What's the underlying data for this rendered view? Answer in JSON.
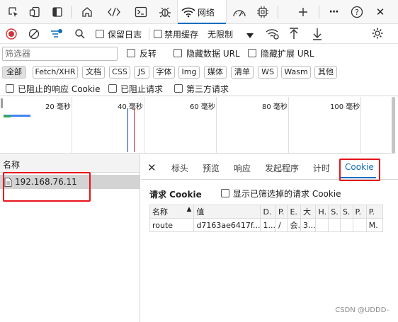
{
  "toolbar": {
    "active_tab_label": "网络",
    "more_label": "···",
    "help_label": "?",
    "close_label": "✕"
  },
  "network_toolbar": {
    "preserve_log_label": "保留日志",
    "disable_cache_label": "禁用缓存",
    "throttle_value": "无限制"
  },
  "filter": {
    "placeholder": "筛选器",
    "invert_label": "反转",
    "hide_data_url_label": "隐藏数据 URL",
    "hide_ext_url_label": "隐藏扩展 URL"
  },
  "type_filters": [
    "全部",
    "Fetch/XHR",
    "文档",
    "CSS",
    "JS",
    "字体",
    "Img",
    "媒体",
    "清单",
    "WS",
    "Wasm",
    "其他"
  ],
  "row3": {
    "blocked_response_cookie": "已阻止的响应 Cookie",
    "blocked_requests": "已阻止请求",
    "third_party_requests": "第三方请求"
  },
  "overview": {
    "ticks": [
      "20 毫秒",
      "40 毫秒",
      "60 毫秒",
      "80 毫秒",
      "100 毫秒"
    ]
  },
  "requests": {
    "name_header": "名称",
    "items": [
      "192.168.76.11"
    ]
  },
  "details": {
    "close_label": "✕",
    "tabs": [
      "标头",
      "预览",
      "响应",
      "发起程序",
      "计时",
      "Cookie"
    ],
    "active_tab": "Cookie",
    "section_title": "请求 Cookie",
    "show_filtered_label": "显示已筛选掉的请求 Cookie",
    "columns": [
      "名称",
      "值",
      "D.",
      "P.",
      "E.",
      "大",
      "H.",
      "S.",
      "S.",
      "P.",
      "P."
    ],
    "rows": [
      [
        "route",
        "d7163ae6417f...",
        "1...",
        "/",
        "会.",
        "3...",
        "",
        "",
        "",
        "",
        "M."
      ]
    ]
  },
  "watermark": "CSDN @UDDD-"
}
